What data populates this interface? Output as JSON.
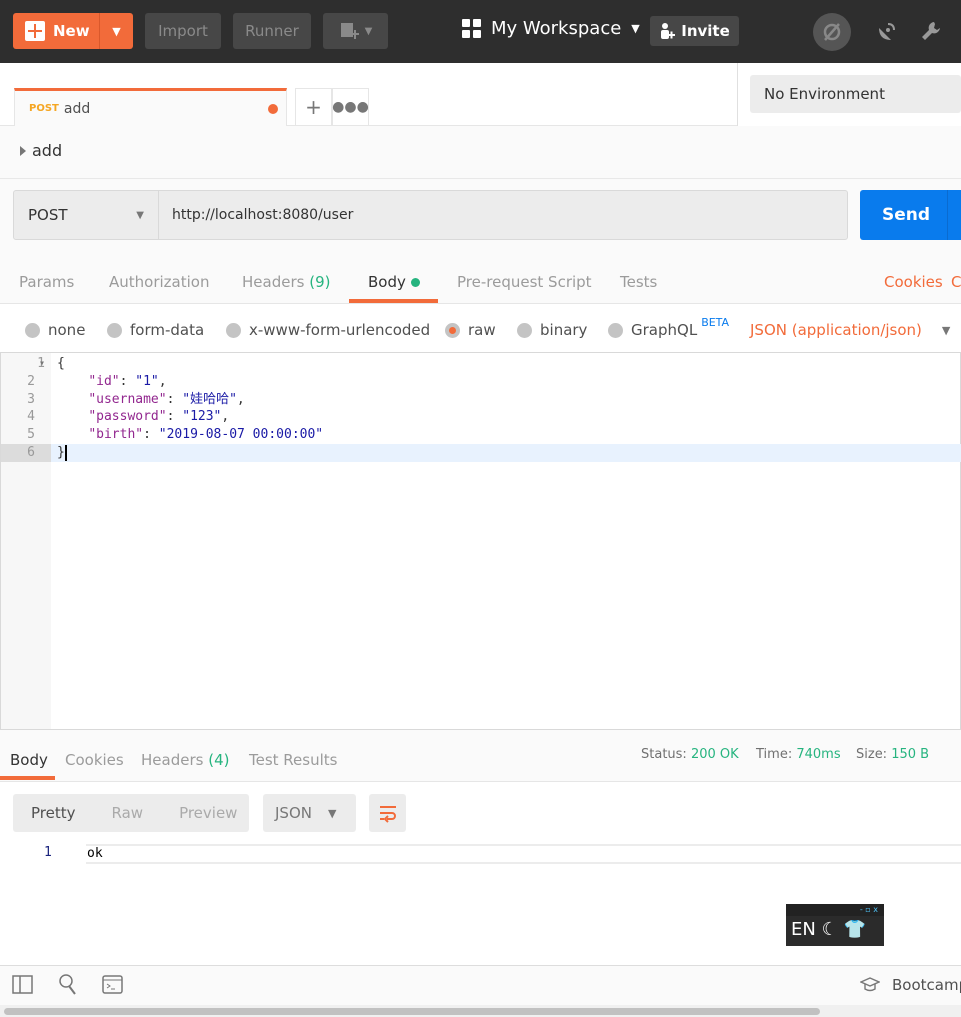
{
  "topbar": {
    "new_label": "New",
    "import_label": "Import",
    "runner_label": "Runner",
    "workspace": "My Workspace",
    "invite_label": "Invite"
  },
  "environment": "No Environment",
  "tab": {
    "method": "POST",
    "name": "add"
  },
  "request": {
    "name": "add",
    "method": "POST",
    "url": "http://localhost:8080/user",
    "send_label": "Send"
  },
  "request_tabs": {
    "params": "Params",
    "authorization": "Authorization",
    "headers": "Headers",
    "headers_count": "(9)",
    "body": "Body",
    "prerequest": "Pre-request Script",
    "tests": "Tests",
    "cookies": "Cookies",
    "code": "C"
  },
  "body_options": {
    "none": "none",
    "form_data": "form-data",
    "urlencoded": "x-www-form-urlencoded",
    "raw": "raw",
    "binary": "binary",
    "graphql": "GraphQL",
    "beta": "BETA",
    "content_type": "JSON (application/json)",
    "selected": "raw"
  },
  "editor": {
    "lines": [
      {
        "n": "1",
        "key": "",
        "val": "",
        "text": "{"
      },
      {
        "n": "2",
        "key": "\"id\"",
        "val": "\"1\"",
        "tail": ","
      },
      {
        "n": "3",
        "key": "\"username\"",
        "val": "\"娃哈哈\"",
        "tail": ","
      },
      {
        "n": "4",
        "key": "\"password\"",
        "val": "\"123\"",
        "tail": ","
      },
      {
        "n": "5",
        "key": "\"birth\"",
        "val": "\"2019-08-07 00:00:00\"",
        "tail": ""
      },
      {
        "n": "6",
        "key": "",
        "val": "",
        "text": "}"
      }
    ]
  },
  "response": {
    "tabs": {
      "body": "Body",
      "cookies": "Cookies",
      "headers": "Headers",
      "headers_count": "(4)",
      "tests": "Test Results"
    },
    "status_label": "Status:",
    "status": "200 OK",
    "time_label": "Time:",
    "time": "740ms",
    "size_label": "Size:",
    "size": "150 B",
    "formats": [
      "Pretty",
      "Raw",
      "Preview"
    ],
    "language": "JSON",
    "line_no": "1",
    "text": "ok"
  },
  "ime": {
    "controls": "- ▫ x",
    "lang": "EN"
  },
  "footer": {
    "bootcamp": "Bootcamp"
  },
  "colors": {
    "accent": "#f26b3a",
    "send": "#097bed",
    "success": "#26b47f"
  }
}
